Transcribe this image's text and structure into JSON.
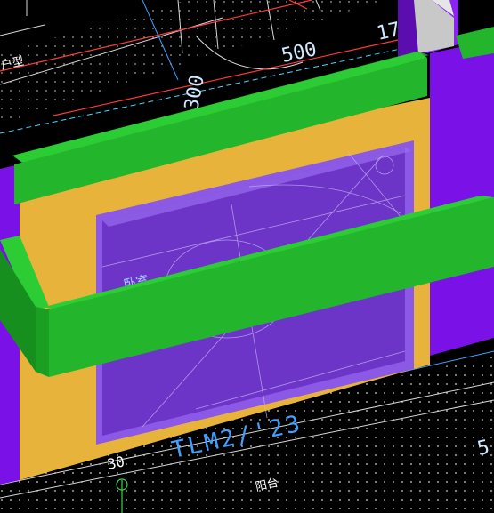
{
  "viewport": {
    "labels": {
      "dim_top_500": "500",
      "dim_left_300": "300",
      "dim_top_17": "17",
      "dim_right_5": "5",
      "dim_bottom_30": "30",
      "room_bedroom": "卧室",
      "tag_tlm": "TLM2/'23",
      "balcony": "阳台",
      "corner_text": "户型"
    },
    "colors": {
      "background": "#000000",
      "green_wall": "#23b52b",
      "purple_wall": "#7a12e8",
      "yellow_wall": "#e7b33a",
      "glass": "#6c35c7",
      "glass_edge": "#8c59e6",
      "cad_white": "#d8d8d8",
      "cad_red": "#ff3a3a",
      "cad_blue": "#40a0ff",
      "cad_cyan": "#47d6ff"
    }
  }
}
